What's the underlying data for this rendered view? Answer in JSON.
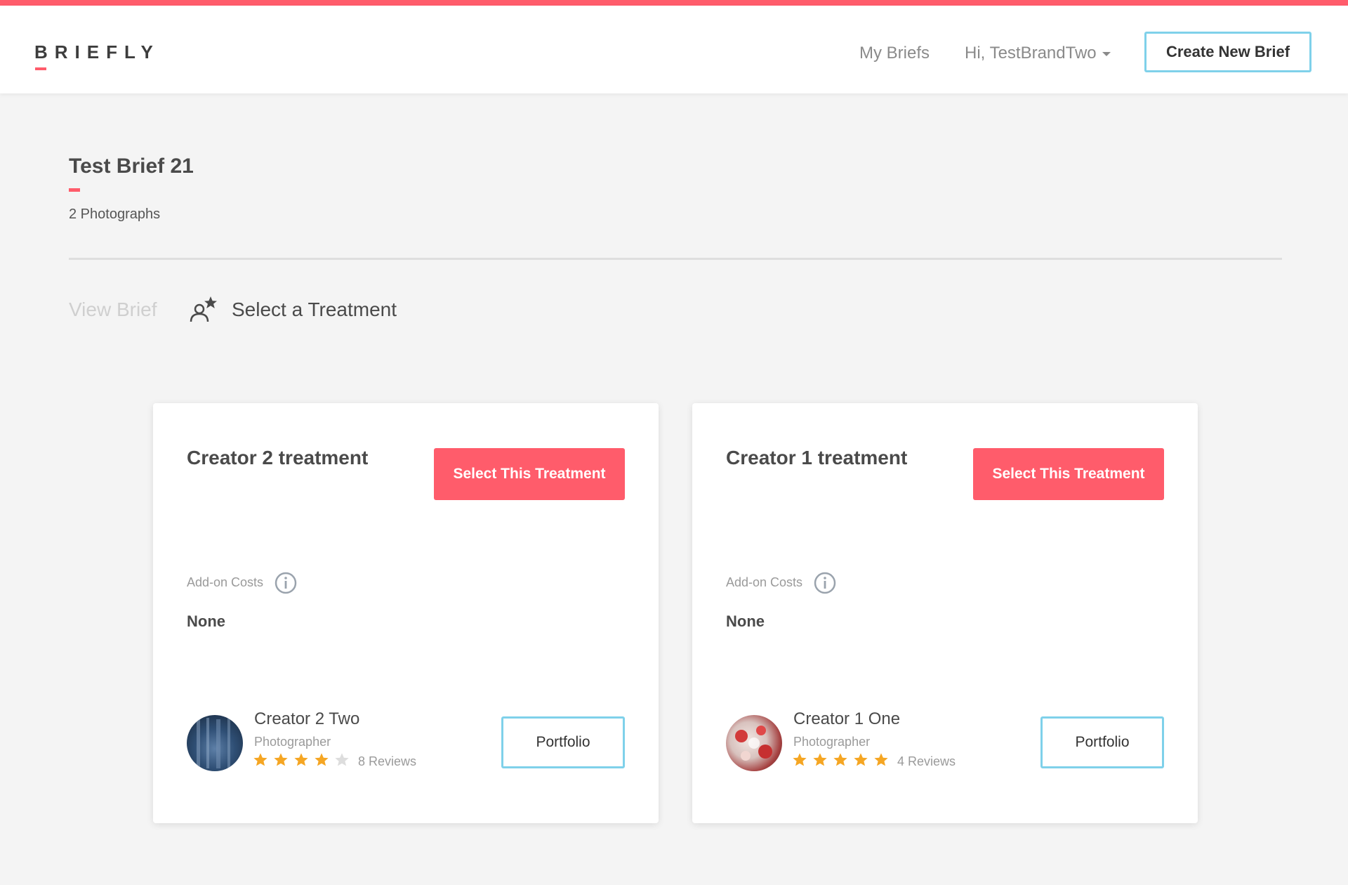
{
  "header": {
    "logo_text": "BRIEFLY",
    "nav": {
      "my_briefs": "My Briefs",
      "user_greeting": "Hi, TestBrandTwo"
    },
    "create_button": "Create New Brief"
  },
  "brief": {
    "title": "Test Brief 21",
    "subtitle": "2 Photographs"
  },
  "tabs": {
    "view_brief": "View Brief",
    "select_treatment": "Select a Treatment"
  },
  "treatments": [
    {
      "title": "Creator 2 treatment",
      "select_label": "Select This Treatment",
      "addon_label": "Add-on Costs",
      "addon_value": "None",
      "creator": {
        "name": "Creator 2 Two",
        "role": "Photographer",
        "rating": 4,
        "max_rating": 5,
        "reviews": "8 Reviews",
        "avatar_icon": "forest-photo"
      },
      "portfolio_label": "Portfolio"
    },
    {
      "title": "Creator 1 treatment",
      "select_label": "Select This Treatment",
      "addon_label": "Add-on Costs",
      "addon_value": "None",
      "creator": {
        "name": "Creator 1 One",
        "role": "Photographer",
        "rating": 5,
        "max_rating": 5,
        "reviews": "4 Reviews",
        "avatar_icon": "flowers-photo"
      },
      "portfolio_label": "Portfolio"
    }
  ],
  "colors": {
    "accent": "#ff5c6b",
    "outline_button": "#7fd1ea",
    "star_filled": "#f5a623",
    "star_empty": "#dddddd"
  }
}
